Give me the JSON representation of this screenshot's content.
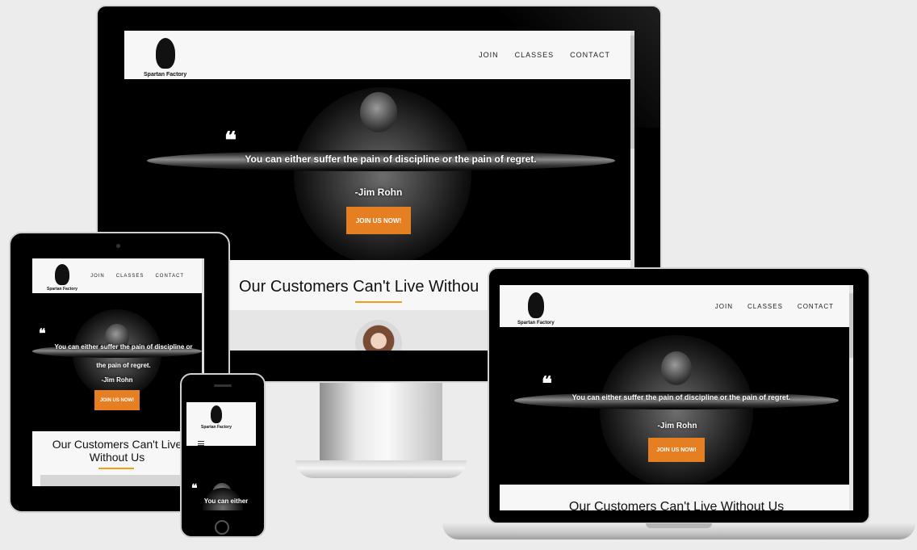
{
  "brand": "Spartan Factory",
  "nav": {
    "join": "JOIN",
    "classes": "CLASSES",
    "contact": "CONTACT"
  },
  "hero": {
    "quote_mark": "❝",
    "quote": "You can either suffer the pain of discipline or the pain of regret.",
    "quote_tablet_line1": "You can either suffer the pain of discipline or",
    "quote_tablet_line2": "the pain of regret.",
    "quote_phone": "You can either",
    "author": "-Jim Rohn",
    "cta": "JOIN US NOW!"
  },
  "section": {
    "title": "Our Customers Can't Live Without Us",
    "title_monitor": "Our Customers Can't Live Withou",
    "title_tablet_line1": "Our Customers Can't Live",
    "title_tablet_line2": "Without Us"
  },
  "menu_icon": "hamburger-icon",
  "colors": {
    "accent": "#e67e22",
    "underline": "#f0a018",
    "nav_bg": "#f7f7f7",
    "hero_bg": "#000000"
  }
}
